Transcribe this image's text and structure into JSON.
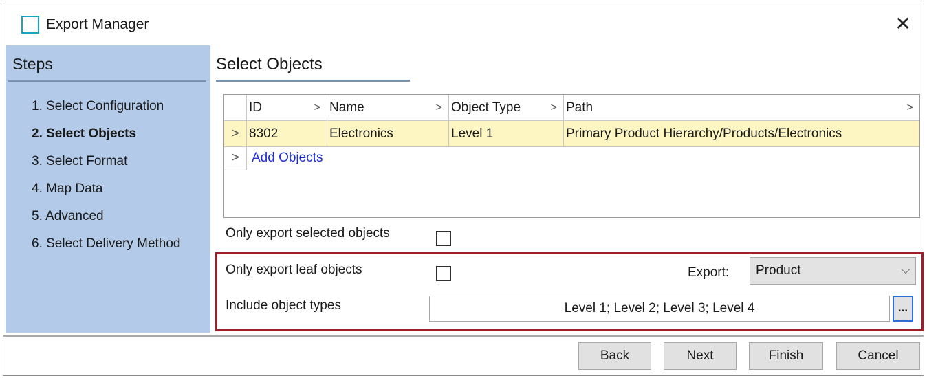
{
  "window": {
    "title": "Export Manager",
    "close_glyph": "✕",
    "icon": "window-icon"
  },
  "sidebar": {
    "title": "Steps",
    "steps": [
      {
        "label": "1. Select Configuration",
        "active": false
      },
      {
        "label": "2. Select Objects",
        "active": true
      },
      {
        "label": "3. Select Format",
        "active": false
      },
      {
        "label": "4. Map Data",
        "active": false
      },
      {
        "label": "5. Advanced",
        "active": false
      },
      {
        "label": "6. Select Delivery Method",
        "active": false
      }
    ]
  },
  "main": {
    "section_title": "Select Objects",
    "grid": {
      "columns": [
        "ID",
        "Name",
        "Object Type",
        "Path"
      ],
      "rows": [
        {
          "id": "8302",
          "name": "Electronics",
          "type": "Level 1",
          "path": "Primary Product Hierarchy/Products/Electronics"
        }
      ],
      "add_label": "Add Objects"
    },
    "only_selected_label": "Only export selected objects",
    "only_leaf_label": "Only export leaf objects",
    "export_label": "Export:",
    "export_value": "Product",
    "include_types_label": "Include object types",
    "include_types_value": "Level 1; Level 2; Level 3; Level 4",
    "ellipsis_label": "..."
  },
  "footer": {
    "back": "Back",
    "next": "Next",
    "finish": "Finish",
    "cancel": "Cancel"
  },
  "colors": {
    "sidebar_bg": "#b3cbe8",
    "highlight_border": "#a11d2a",
    "selected_row": "#fdf5c2",
    "link": "#1f2fd8"
  }
}
